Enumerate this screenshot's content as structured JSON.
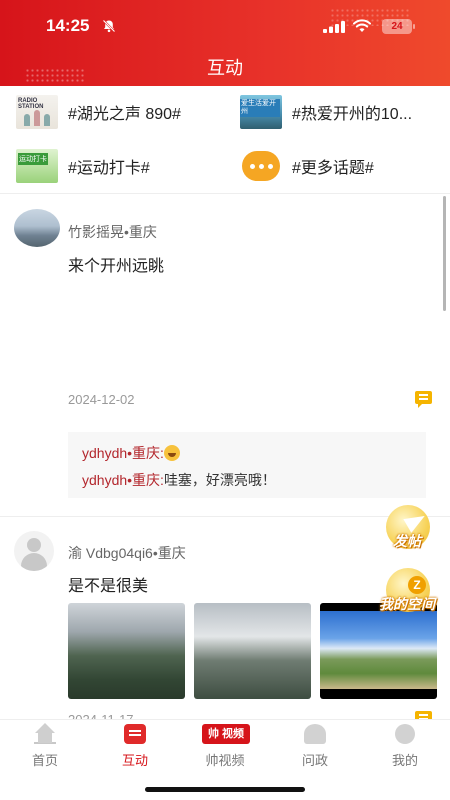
{
  "status_bar": {
    "time": "14:25",
    "battery": "24"
  },
  "header": {
    "title": "互动"
  },
  "topics": [
    {
      "label": "#湖光之声 890#",
      "thumb_text": "RADIO STATION"
    },
    {
      "label": "#热爱开州的10...",
      "thumb_text": "爱生活爱开州"
    },
    {
      "label": "#运动打卡#",
      "thumb_text": "运动打卡"
    },
    {
      "label": "#更多话题#"
    }
  ],
  "posts": [
    {
      "author": "竹影摇晃•重庆",
      "content": "来个开州远眺",
      "date": "2024-12-02",
      "replies": [
        {
          "user": "ydhydh•重庆:",
          "text": ""
        },
        {
          "user": "ydhydh•重庆:",
          "text": "哇塞，好漂亮哦！"
        }
      ]
    },
    {
      "author": "渝 Vdbg04qi6•重庆",
      "content": "是不是很美",
      "date": "2024-11-17"
    }
  ],
  "floating": {
    "post_label": "发帖",
    "space_label": "我的空间"
  },
  "tabs": [
    {
      "label": "首页"
    },
    {
      "label": "互动"
    },
    {
      "label": "帅视频",
      "icon_text": "帅 视频"
    },
    {
      "label": "问政"
    },
    {
      "label": "我的"
    }
  ],
  "colors": {
    "brand": "#d6141a",
    "accent": "#f5b400"
  }
}
